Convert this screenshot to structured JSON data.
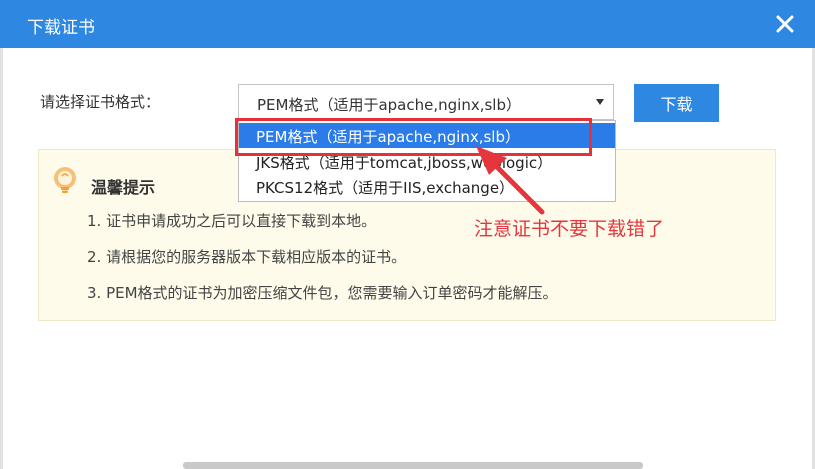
{
  "dialog": {
    "title": "下载证书",
    "close_icon": "close-icon",
    "accent_color": "#2e87e0"
  },
  "form": {
    "label": "请选择证书格式：",
    "selected_value": "PEM格式（适用于apache,nginx,slb）",
    "download_label": "下载"
  },
  "dropdown": {
    "options": [
      "PEM格式（适用于apache,nginx,slb）",
      "JKS格式（适用于tomcat,jboss,weblogic）",
      "PKCS12格式（适用于IIS,exchange）"
    ],
    "selected_index": 0
  },
  "tips": {
    "icon": "lightbulb-icon",
    "title": "温馨提示",
    "items": [
      "1. 证书申请成功之后可以直接下载到本地。",
      "2. 请根据您的服务器版本下载相应版本的证书。",
      "3. PEM格式的证书为加密压缩文件包，您需要输入订单密码才能解压。"
    ]
  },
  "annotation": {
    "text": "注意证书不要下载错了",
    "color": "#e5363d"
  }
}
